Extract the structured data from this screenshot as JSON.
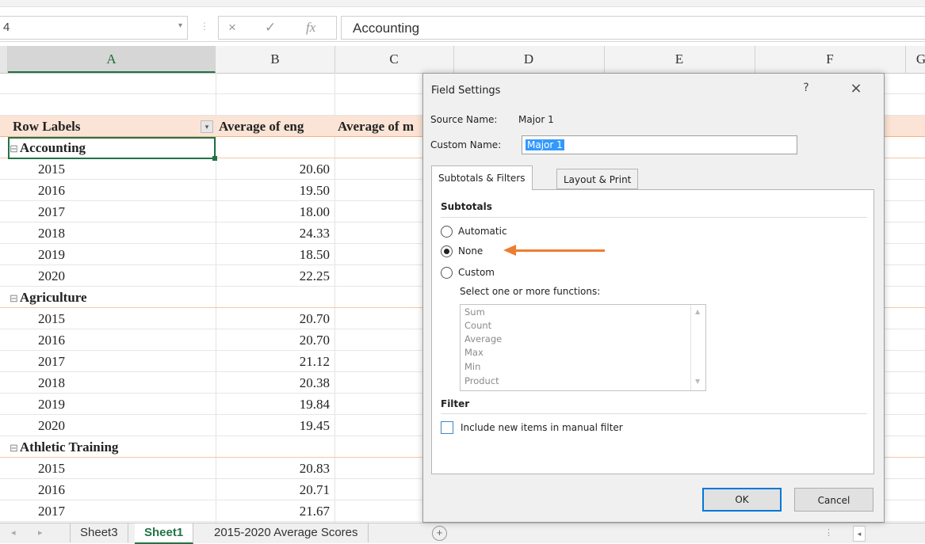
{
  "formula_bar": {
    "name_box": "4",
    "cancel_icon": "×",
    "enter_icon": "✓",
    "fx_label": "fx",
    "formula": "Accounting"
  },
  "columns": [
    "A",
    "B",
    "C",
    "D",
    "E",
    "F",
    "G"
  ],
  "pivot": {
    "header": {
      "row_labels": "Row Labels",
      "col_b": "Average of eng",
      "col_c": "Average of m"
    },
    "groups": [
      {
        "name": "Accounting",
        "rows": [
          {
            "year": "2015",
            "value": "20.60"
          },
          {
            "year": "2016",
            "value": "19.50"
          },
          {
            "year": "2017",
            "value": "18.00"
          },
          {
            "year": "2018",
            "value": "24.33"
          },
          {
            "year": "2019",
            "value": "18.50"
          },
          {
            "year": "2020",
            "value": "22.25"
          }
        ]
      },
      {
        "name": "Agriculture",
        "rows": [
          {
            "year": "2015",
            "value": "20.70"
          },
          {
            "year": "2016",
            "value": "20.70"
          },
          {
            "year": "2017",
            "value": "21.12"
          },
          {
            "year": "2018",
            "value": "20.38"
          },
          {
            "year": "2019",
            "value": "19.84"
          },
          {
            "year": "2020",
            "value": "19.45"
          }
        ]
      },
      {
        "name": "Athletic Training",
        "rows": [
          {
            "year": "2015",
            "value": "20.83"
          },
          {
            "year": "2016",
            "value": "20.71"
          },
          {
            "year": "2017",
            "value": "21.67"
          }
        ]
      }
    ]
  },
  "sheet_tabs": [
    "Sheet3",
    "Sheet1",
    "2015-2020 Average Scores"
  ],
  "active_sheet": "Sheet1",
  "dialog": {
    "title": "Field Settings",
    "help": "?",
    "close": "×",
    "source_name_label": "Source Name:",
    "source_name": "Major 1",
    "custom_name_label": "Custom Name:",
    "custom_name": "Major 1",
    "tabs": [
      "Subtotals & Filters",
      "Layout & Print"
    ],
    "subtotals_heading": "Subtotals",
    "options": [
      "Automatic",
      "None",
      "Custom"
    ],
    "selected_option": "None",
    "functions_label": "Select one or more functions:",
    "functions": [
      "Sum",
      "Count",
      "Average",
      "Max",
      "Min",
      "Product"
    ],
    "filter_heading": "Filter",
    "filter_checkbox_label": "Include new items in manual filter",
    "ok_label": "OK",
    "cancel_label": "Cancel"
  },
  "colors": {
    "accent": "#217346",
    "pivot_header_fill": "#fbe4d5",
    "annotation_arrow": "#ed7d31",
    "ok_focus": "#0078d7"
  }
}
